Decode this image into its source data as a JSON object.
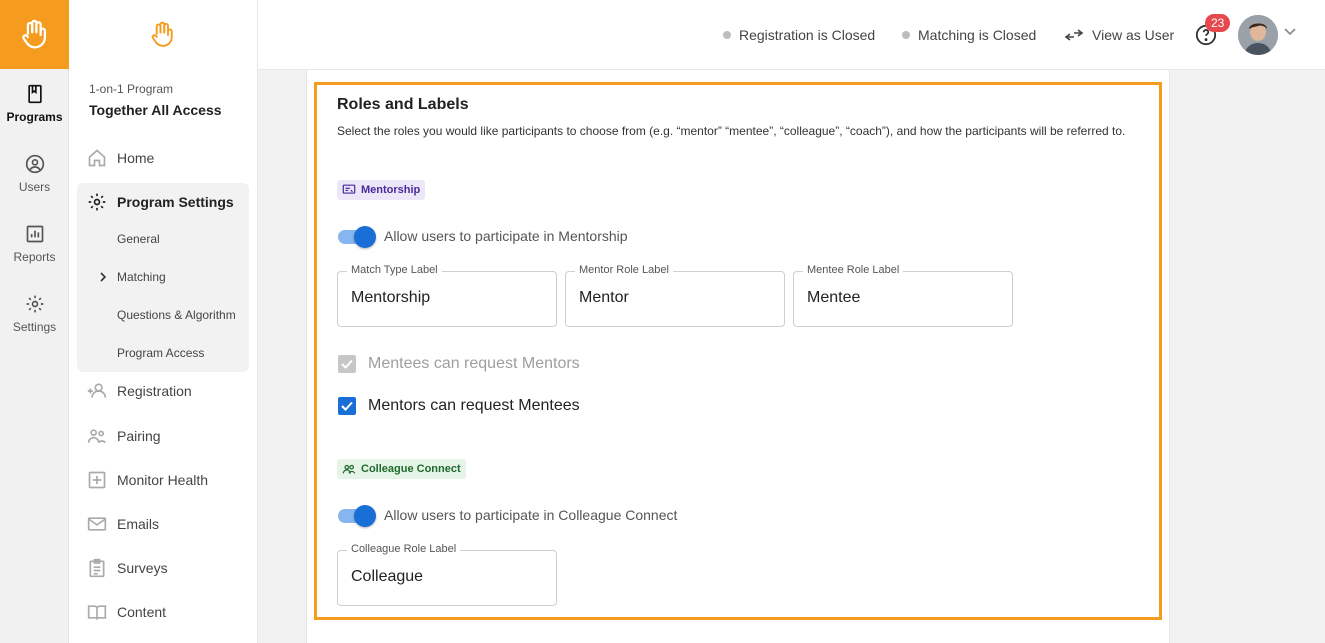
{
  "rail": {
    "items": [
      {
        "label": "Programs"
      },
      {
        "label": "Users"
      },
      {
        "label": "Reports"
      },
      {
        "label": "Settings"
      }
    ]
  },
  "sidebar": {
    "program_type": "1-on-1 Program",
    "program_name": "Together All Access",
    "home": "Home",
    "program_settings": "Program Settings",
    "settings_sub": [
      "General",
      "Matching",
      "Questions & Algorithm",
      "Program Access"
    ],
    "registration": "Registration",
    "pairing": "Pairing",
    "monitor_health": "Monitor Health",
    "emails": "Emails",
    "surveys": "Surveys",
    "content": "Content"
  },
  "topbar": {
    "registration_status": "Registration is Closed",
    "matching_status": "Matching is Closed",
    "view_as_user": "View as User",
    "notification_count": "23"
  },
  "roles": {
    "title": "Roles and Labels",
    "description": "Select the roles you would like participants to choose from (e.g. “mentor” “mentee”, “colleague”, “coach”), and how the participants will be referred to.",
    "mentorship": {
      "chip": "Mentorship",
      "toggle_label": "Allow users to participate in Mentorship",
      "toggle_on": true,
      "fields": [
        {
          "label": "Match Type Label",
          "value": "Mentorship"
        },
        {
          "label": "Mentor Role Label",
          "value": "Mentor"
        },
        {
          "label": "Mentee Role Label",
          "value": "Mentee"
        }
      ],
      "mentees_request": "Mentees can request Mentors",
      "mentors_request": "Mentors can request Mentees"
    },
    "colleague": {
      "chip": "Colleague Connect",
      "toggle_label": "Allow users to participate in Colleague Connect",
      "toggle_on": true,
      "field": {
        "label": "Colleague Role Label",
        "value": "Colleague"
      }
    }
  },
  "colors": {
    "brand_orange": "#f59b1d",
    "toggle_blue": "#1a6fd6",
    "mentorship_chip_bg": "#ece7f8",
    "mentorship_chip_text": "#4a2a9a",
    "colleague_chip_bg": "#e6f4e8",
    "colleague_chip_text": "#1e6b2d",
    "badge_red": "#e5494d"
  }
}
